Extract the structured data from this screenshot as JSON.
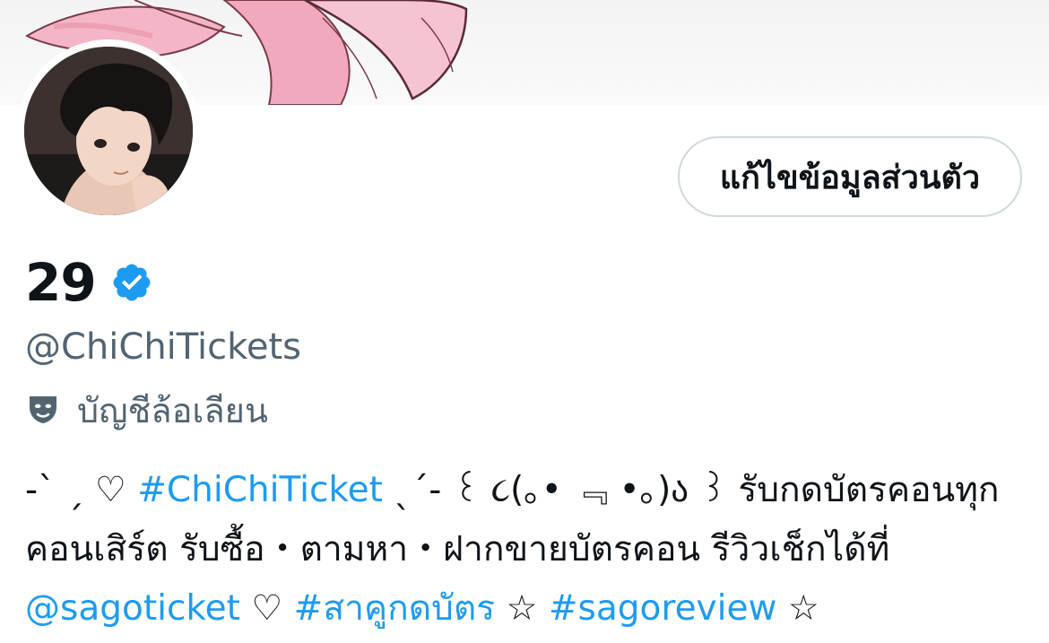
{
  "banner": {
    "image_name": "pink-flower-illustration"
  },
  "avatar": {
    "image_name": "anime-boy-portrait"
  },
  "edit_profile_label": "แก้ไขข้อมูลส่วนตัว",
  "profile": {
    "display_name": "29",
    "handle": "@ChiChiTickets",
    "parody_label": "บัญชีล้อเลียน"
  },
  "bio": {
    "line1_prefix": "-` ˏ ♡ ",
    "line1_hashtag": "#ChiChiTicket",
    "line1_suffix": " ˎˊ- ꒰ ૮(｡• ﹃ •｡)ა ꒱ รับกดบัตรคอนทุก",
    "line2": "คอนเสิร์ต รับซื้อ・ตามหา・ฝากขายบัตรคอน รีวิวเช็กได้ที่",
    "line3_mention": "@sagoticket",
    "line3_sep1": " ♡ ",
    "line3_hashtag1": "#สาคูกดบัตร",
    "line3_sep2": " ☆ ",
    "line3_hashtag2": "#sagoreview",
    "line3_end": " ☆"
  },
  "colors": {
    "link": "#1d9bf0",
    "verified": "#1d9bf0",
    "muted": "#536471",
    "text": "#0f1419"
  }
}
